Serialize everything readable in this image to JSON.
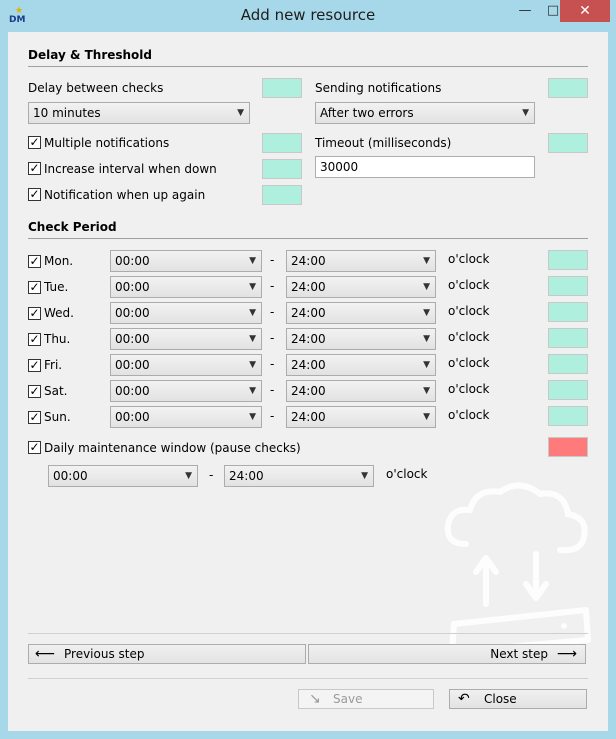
{
  "window": {
    "title": "Add new resource",
    "icon_text": "DM",
    "icons": {
      "minimize": "minimize-icon",
      "maximize": "maximize-icon",
      "close": "close-icon"
    }
  },
  "colors": {
    "swatch_green": "#aef0dd",
    "swatch_red": "#ff7b7b",
    "titlebar": "#a6d8e9",
    "close": "#c75050"
  },
  "delay": {
    "section_title": "Delay & Threshold",
    "delay_label": "Delay between checks",
    "delay_value": "10 minutes",
    "sending_label": "Sending notifications",
    "sending_value": "After two errors",
    "multiple_label": "Multiple notifications",
    "multiple_checked": true,
    "increase_label": "Increase interval when down",
    "increase_checked": true,
    "up_label": "Notification when up again",
    "up_checked": true,
    "timeout_label": "Timeout (milliseconds)",
    "timeout_value": "30000"
  },
  "period": {
    "section_title": "Check Period",
    "oclock": "o'clock",
    "dash": "-",
    "days": [
      {
        "label": "Mon.",
        "from": "00:00",
        "to": "24:00",
        "checked": true
      },
      {
        "label": "Tue.",
        "from": "00:00",
        "to": "24:00",
        "checked": true
      },
      {
        "label": "Wed.",
        "from": "00:00",
        "to": "24:00",
        "checked": true
      },
      {
        "label": "Thu.",
        "from": "00:00",
        "to": "24:00",
        "checked": true
      },
      {
        "label": "Fri.",
        "from": "00:00",
        "to": "24:00",
        "checked": true
      },
      {
        "label": "Sat.",
        "from": "00:00",
        "to": "24:00",
        "checked": true
      },
      {
        "label": "Sun.",
        "from": "00:00",
        "to": "24:00",
        "checked": true
      }
    ],
    "maintenance_label": "Daily maintenance window (pause checks)",
    "maintenance_checked": true,
    "maintenance_from": "00:00",
    "maintenance_to": "24:00"
  },
  "nav": {
    "previous_label": "Previous step",
    "next_label": "Next step",
    "save_label": "Save",
    "close_label": "Close"
  }
}
